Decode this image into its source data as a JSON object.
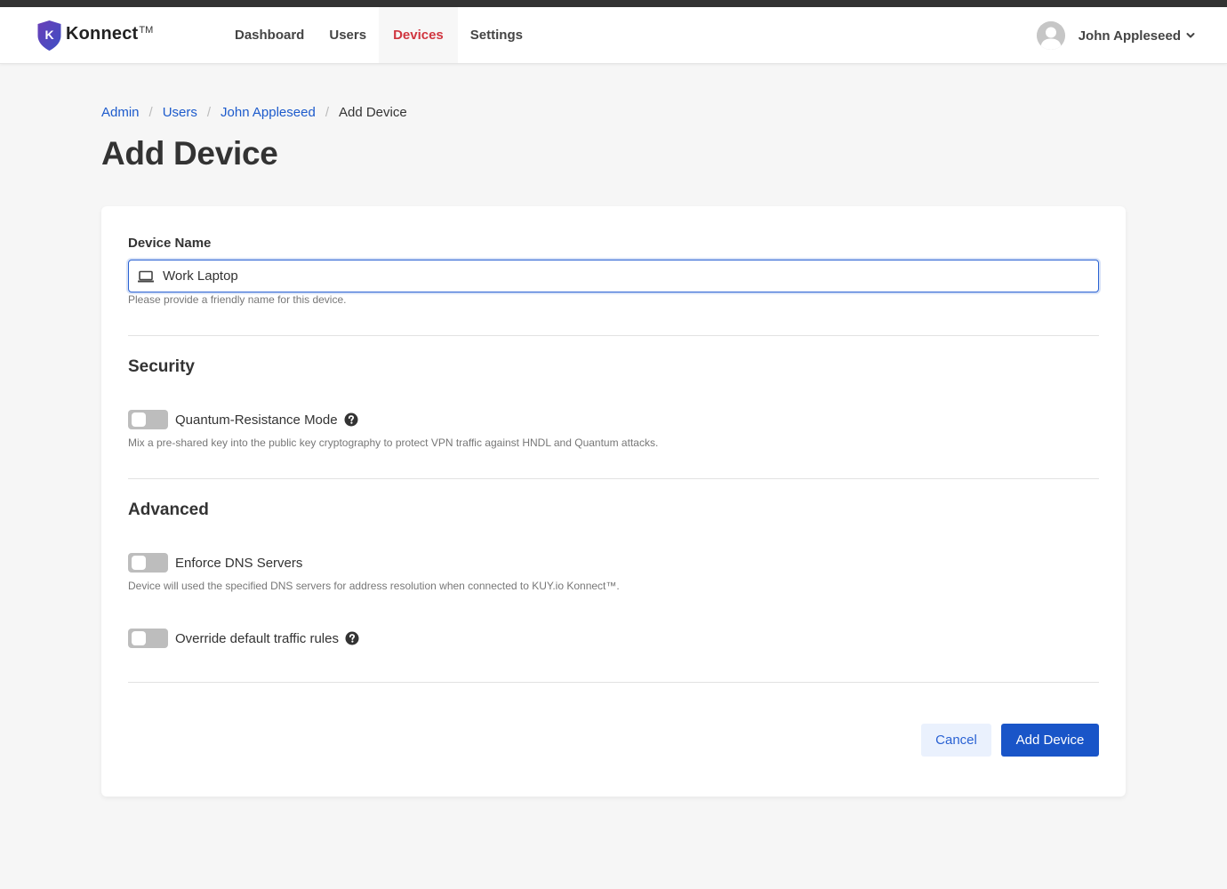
{
  "app": {
    "brand_name": "Konnect",
    "brand_tm": "TM",
    "brand_logo_letter": "K",
    "colors": {
      "accent": "#1955c8",
      "link": "#1d5bcc",
      "nav_active": "#d0353f",
      "topbar": "#333333",
      "logo_purple": "#5b3fb5"
    }
  },
  "nav": {
    "items": [
      {
        "label": "Dashboard",
        "active": false
      },
      {
        "label": "Users",
        "active": false
      },
      {
        "label": "Devices",
        "active": true
      },
      {
        "label": "Settings",
        "active": false
      }
    ]
  },
  "user_menu": {
    "name": "John Appleseed",
    "avatar_icon": "user-avatar-icon",
    "dropdown_icon": "chevron-down-icon"
  },
  "breadcrumb": [
    {
      "label": "Admin",
      "link": true
    },
    {
      "label": "Users",
      "link": true
    },
    {
      "label": "John Appleseed",
      "link": true
    },
    {
      "label": "Add Device",
      "link": false
    }
  ],
  "breadcrumb_separator": "/",
  "page": {
    "title": "Add Device"
  },
  "form": {
    "device_name": {
      "label": "Device Name",
      "value": "Work Laptop",
      "placeholder": "",
      "icon": "laptop-icon",
      "help": "Please provide a friendly name for this device."
    },
    "sections": [
      {
        "title": "Security",
        "toggles": [
          {
            "label": "Quantum-Resistance Mode",
            "on": false,
            "has_help_icon": true,
            "help": "Mix a pre-shared key into the public key cryptography to protect VPN traffic against HNDL and Quantum attacks."
          }
        ]
      },
      {
        "title": "Advanced",
        "toggles": [
          {
            "label": "Enforce DNS Servers",
            "on": false,
            "has_help_icon": false,
            "help": "Device will used the specified DNS servers for address resolution when connected to KUY.io Konnect™."
          },
          {
            "label": "Override default traffic rules",
            "on": false,
            "has_help_icon": true,
            "help": ""
          }
        ]
      }
    ],
    "buttons": {
      "cancel": "Cancel",
      "submit": "Add Device"
    }
  }
}
